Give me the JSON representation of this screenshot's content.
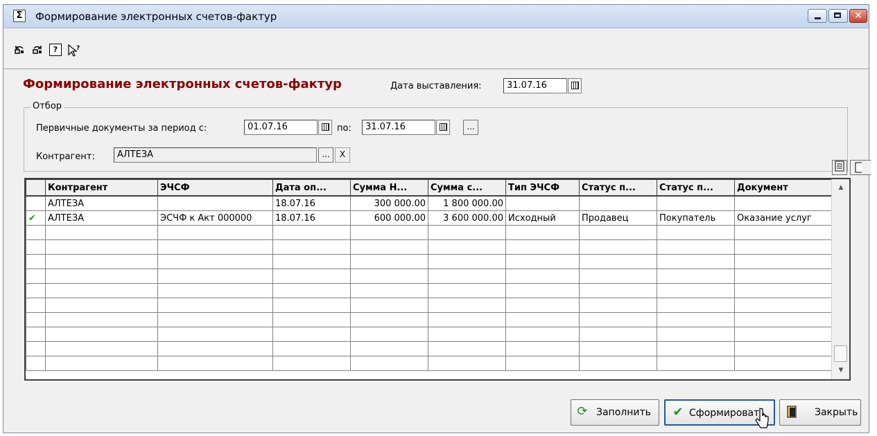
{
  "window": {
    "title": "Формирование электронных счетов-фактур",
    "app_icon": "sigma-icon"
  },
  "toolbar": {
    "icons": [
      "undo-icon",
      "redo-icon",
      "help-icon",
      "context-help-icon"
    ],
    "help_glyph": "?"
  },
  "header": {
    "heading": "Формирование электронных счетов-фактур",
    "issue_date_label": "Дата выставления:",
    "issue_date": "31.07.16"
  },
  "filter": {
    "legend": "Отбор",
    "period_label": "Первичные документы за период с:",
    "date_from": "01.07.16",
    "to_label": "по:",
    "date_to": "31.07.16",
    "more_btn": "...",
    "counterparty_label": "Контрагент:",
    "counterparty": "АЛТЕЗА",
    "pick_btn": "...",
    "clear_btn": "X"
  },
  "grid": {
    "columns": [
      "",
      "Контрагент",
      "ЭЧСФ",
      "Дата оп...",
      "Сумма Н...",
      "Сумма с...",
      "Тип ЭЧСФ",
      "Статус п...",
      "Статус п...",
      "Документ"
    ],
    "rows": [
      {
        "checked": false,
        "cells": [
          "АЛТЕЗА",
          "",
          "18.07.16",
          "300 000.00",
          "1 800 000.00",
          "",
          "",
          "",
          ""
        ]
      },
      {
        "checked": true,
        "cells": [
          "АЛТЕЗА",
          "ЭСЧФ к Акт 000000",
          "18.07.16",
          "600 000.00",
          "3 600 000.00",
          "Исходный",
          "Продавец",
          "Покупатель",
          "Оказание услуг"
        ]
      }
    ],
    "empty_rows": 10
  },
  "buttons": {
    "fill": "Заполнить",
    "generate": "Сформировать",
    "close": "Закрыть"
  },
  "colors": {
    "heading": "#8b0000",
    "check": "#1a9a1a",
    "refresh": "#2f8f2f"
  }
}
